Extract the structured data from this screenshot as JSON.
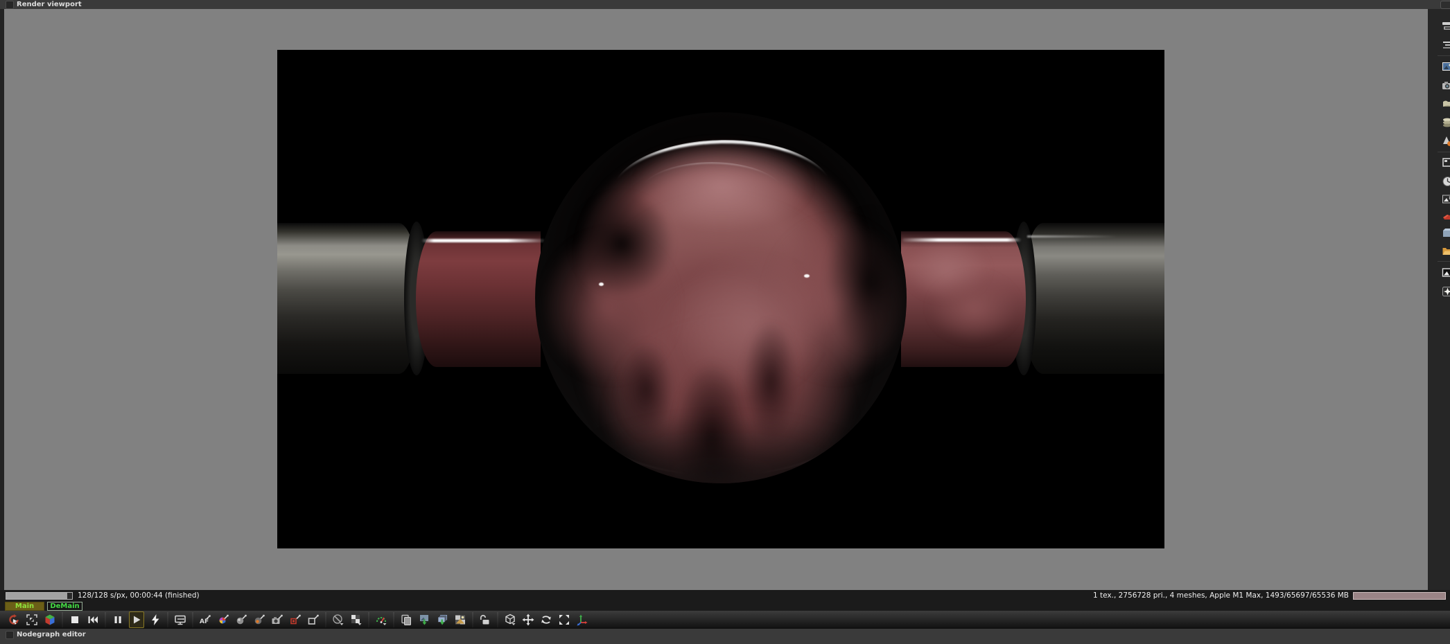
{
  "panels": {
    "render_viewport": {
      "title": "Render viewport"
    },
    "nodegraph": {
      "title": "Nodegraph editor"
    }
  },
  "status_bar": {
    "render_progress": {
      "label": "128/128 s/px, 00:00:44 (finished)",
      "percent_filled": 93
    },
    "stats": "1 tex., 2756728 pri., 4 meshes, Apple M1 Max, 1493/65697/65536 MB",
    "memory_bar_percent_filled": 100
  },
  "render_tabs": [
    {
      "label": "Main",
      "active": true
    },
    {
      "label": "DeMain",
      "active": false
    }
  ],
  "toolbar": {
    "active_button": "start-render",
    "buttons": [
      "recenter-view",
      "fit-resolution",
      "render-priority-cube",
      "stop-render",
      "restart-render",
      "pause-render",
      "start-render",
      "realtime-render",
      "subsampling-display",
      "autofocus-picker",
      "white-balance-picker",
      "material-picker",
      "focus-picker",
      "camera-picker",
      "object-picker",
      "render-region-picker",
      "clay-mode",
      "alpha-background",
      "render-priority-gauge",
      "copy-to-clipboard",
      "save-image",
      "save-render-passes",
      "set-background-image",
      "lock-viewport",
      "camera-navigation-mode",
      "pan-tool",
      "orbit-tool",
      "fit-to-view",
      "world-axes"
    ]
  },
  "sidebar": {
    "icons": [
      "render-target",
      "render-layers",
      "texture-image",
      "camera",
      "material-library",
      "node-stack",
      "light",
      "framing",
      "animation-clock",
      "image-adjustment",
      "red-material",
      "object-box",
      "file-folder",
      "bw-image",
      "star-effect"
    ]
  },
  "render_preview": {
    "subject": "glass sphere filled with pink volumetric cloud joined to two horizontal metal pipes on black background",
    "colors": {
      "background": "#000000",
      "cloud_mid": "#8f5a5c",
      "cloud_highlight": "#b38082",
      "cloud_shadow": "#2a1214",
      "metal_highlight": "#98978f",
      "tube_contents": "#6b3134",
      "specular": "#ffffff"
    }
  },
  "colors": {
    "viewport_bg": "#818181",
    "panel_bg": "#1b1b1b",
    "titlebar_bg": "#3a3a3a",
    "active_tab_bg": "#6b5f17",
    "tab_text_green": "#44dc44",
    "toolbar_active_border": "#8a7a26",
    "memory_bar_fill": "#9a8486"
  }
}
